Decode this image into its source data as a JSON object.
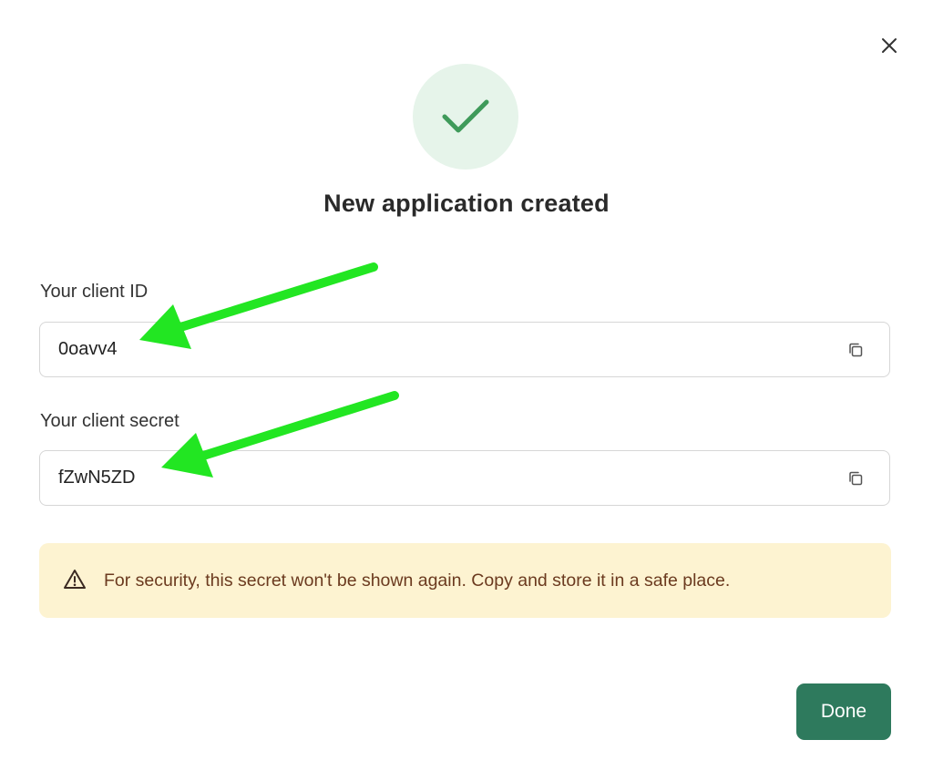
{
  "dialog": {
    "title": "New application created",
    "close_icon": "close-icon",
    "success_icon": "checkmark-icon",
    "colors": {
      "success_bg": "#e6f4ea",
      "success_check": "#3f9a5a",
      "warning_bg": "#fdf3d1",
      "warning_text": "#6b3a1f",
      "primary_button": "#2e7a5d",
      "annotation_arrow": "#22e622"
    }
  },
  "client_id": {
    "label": "Your client ID",
    "value": "0oavv4",
    "copy_icon": "copy-icon"
  },
  "client_secret": {
    "label": "Your client secret",
    "value": "fZwN5ZD",
    "copy_icon": "copy-icon"
  },
  "warning": {
    "icon": "warning-triangle-icon",
    "text": "For security, this secret won't be shown again. Copy and store it in a safe place."
  },
  "actions": {
    "done_label": "Done"
  }
}
